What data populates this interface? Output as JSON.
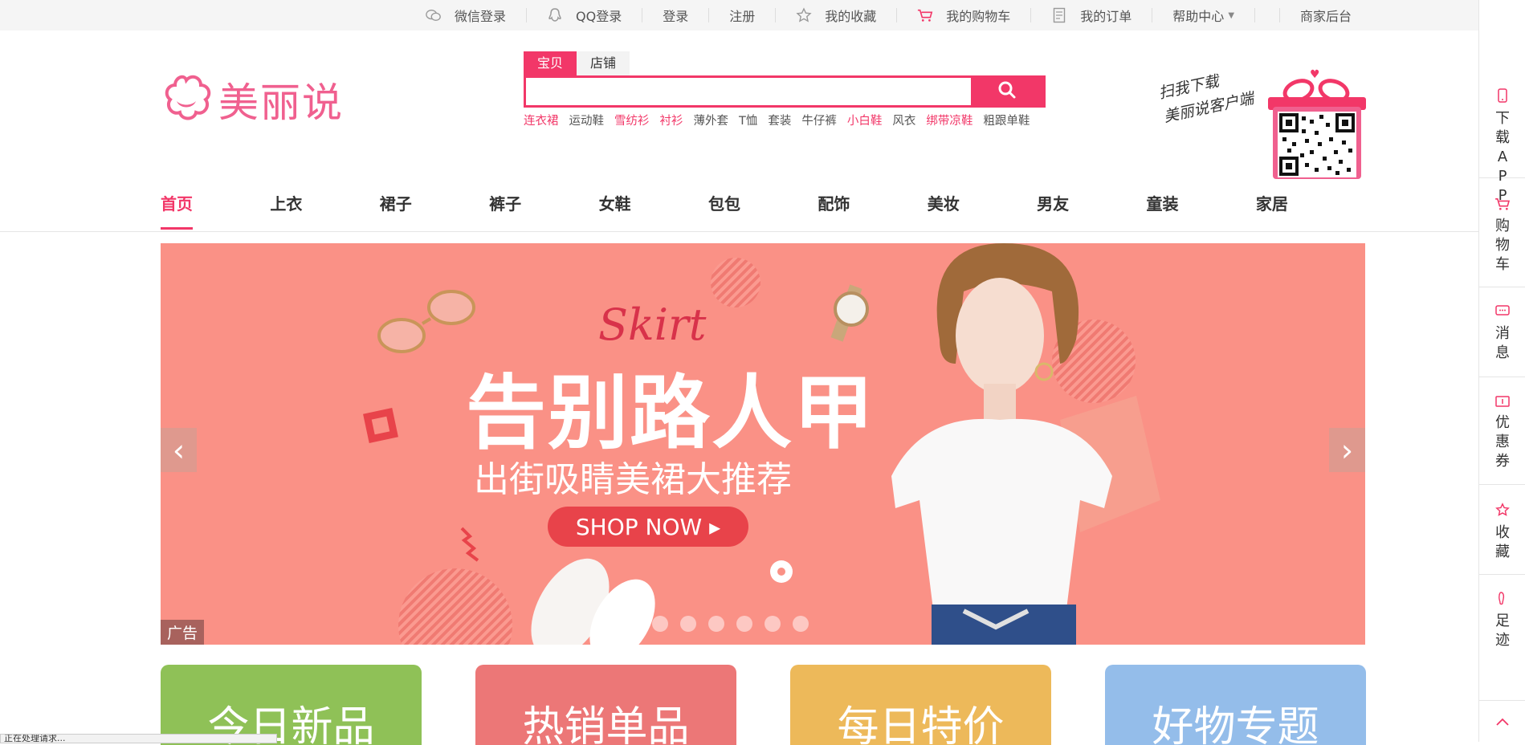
{
  "topbar": {
    "wechat_login": "微信登录",
    "qq_login": "QQ登录",
    "login": "登录",
    "register": "注册",
    "favorites": "我的收藏",
    "cart": "我的购物车",
    "orders": "我的订单",
    "help": "帮助中心",
    "merchant": "商家后台"
  },
  "logo": {
    "text": "美丽说"
  },
  "search": {
    "tabs": [
      "宝贝",
      "店铺"
    ],
    "placeholder": "",
    "hot_keywords": [
      {
        "text": "连衣裙",
        "highlight": true
      },
      {
        "text": "运动鞋",
        "highlight": false
      },
      {
        "text": "雪纺衫",
        "highlight": true
      },
      {
        "text": "衬衫",
        "highlight": true
      },
      {
        "text": "薄外套",
        "highlight": false
      },
      {
        "text": "T恤",
        "highlight": false
      },
      {
        "text": "套装",
        "highlight": false
      },
      {
        "text": "牛仔裤",
        "highlight": false
      },
      {
        "text": "小白鞋",
        "highlight": true
      },
      {
        "text": "风衣",
        "highlight": false
      },
      {
        "text": "绑带凉鞋",
        "highlight": true
      },
      {
        "text": "粗跟单鞋",
        "highlight": false
      }
    ]
  },
  "qr": {
    "note_line1": "扫我下载",
    "note_line2": "美丽说客户端"
  },
  "nav": {
    "items": [
      "首页",
      "上衣",
      "裙子",
      "裤子",
      "女鞋",
      "包包",
      "配饰",
      "美妆",
      "男友",
      "童装",
      "家居"
    ]
  },
  "banner": {
    "script": "Skirt",
    "title": "告别路人甲",
    "subtitle": "出街吸睛美裙大推荐",
    "cta": "SHOP NOW ▸",
    "ad_tag": "广告",
    "prev": "‹",
    "next": "›"
  },
  "cards": [
    {
      "label": "今日新品",
      "color": "#8fc157"
    },
    {
      "label": "热销单品",
      "color": "#ec7777"
    },
    {
      "label": "每日特价",
      "color": "#edb95a"
    },
    {
      "label": "好物专题",
      "color": "#94bdea"
    }
  ],
  "sidebar": {
    "app": "下载APP",
    "cart": "购物车",
    "message": "消息",
    "coupon": "优惠券",
    "favorite": "收藏",
    "footprint": "足迹"
  },
  "status": {
    "text": "正在处理请求..."
  },
  "colors": {
    "accent": "#f23768",
    "logo": "#f0608f"
  }
}
